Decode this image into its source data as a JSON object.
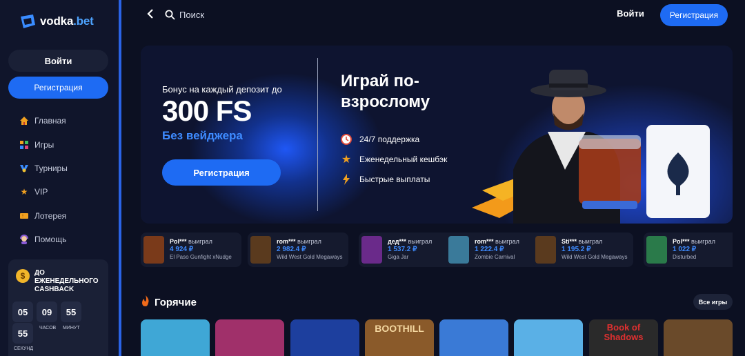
{
  "brand": {
    "name_main": "vodka",
    "name_accent": ".bet"
  },
  "sidebar": {
    "login_label": "Войти",
    "register_label": "Регистрация",
    "nav": [
      {
        "label": "Главная",
        "icon": "home-icon"
      },
      {
        "label": "Игры",
        "icon": "games-grid-icon"
      },
      {
        "label": "Турниры",
        "icon": "tournament-cup-icon"
      },
      {
        "label": "VIP",
        "icon": "star-icon"
      },
      {
        "label": "Лотерея",
        "icon": "ticket-icon"
      },
      {
        "label": "Помощь",
        "icon": "support-icon"
      }
    ],
    "cashback": {
      "title": "ДО ЕЖЕНЕДЕЛЬНОГО CASHBACK",
      "timer": [
        {
          "value": "05",
          "label": ""
        },
        {
          "value": "09",
          "label": "ЧАСОВ"
        },
        {
          "value": "55",
          "label": "МИНУТ"
        },
        {
          "value": "55",
          "label": "СЕКУНД"
        }
      ]
    }
  },
  "header": {
    "search_label": "Поиск",
    "login_label": "Войти",
    "register_label": "Регистрация"
  },
  "banner": {
    "bonus_text": "Бонус на каждый депозит до",
    "big_text": "300 FS",
    "subtext": "Без вейджера",
    "register_label": "Регистрация",
    "headline": "Играй по-взрослому",
    "features": [
      {
        "label": "24/7 поддержка",
        "icon": "clock-icon"
      },
      {
        "label": "Еженедельный кешбэк",
        "icon": "star-icon"
      },
      {
        "label": "Быстрые выплаты",
        "icon": "lightning-icon"
      }
    ]
  },
  "winners": [
    {
      "user": "Pol***",
      "won": "выиграл",
      "amount": "4 924 ₽",
      "game": "El Paso Gunfight xNudge",
      "color": "#7a3a1a"
    },
    {
      "user": "rom***",
      "won": "выиграл",
      "amount": "2 982.4 ₽",
      "game": "Wild West Gold Megaways",
      "color": "#5a3a1e"
    },
    {
      "user": "дед***",
      "won": "выиграл",
      "amount": "1 537.2 ₽",
      "game": "Giga Jar",
      "color": "#6a2a8a"
    },
    {
      "user": "rom***",
      "won": "выиграл",
      "amount": "1 222.4 ₽",
      "game": "Zombie Carnival",
      "color": "#3a7a9a"
    },
    {
      "user": "Sti***",
      "won": "выиграл",
      "amount": "1 195.2 ₽",
      "game": "Wild West Gold Megaways",
      "color": "#5a3a1e"
    },
    {
      "user": "Pol***",
      "won": "выиграл",
      "amount": "1 022 ₽",
      "game": "Disturbed",
      "color": "#2a7a4a"
    }
  ],
  "hot": {
    "title": "Горячие",
    "all_label": "Все игры",
    "games": [
      {
        "label": "",
        "color": "#3fa7d6"
      },
      {
        "label": "",
        "color": "#a0306a"
      },
      {
        "label": "",
        "color": "#1d3f9e"
      },
      {
        "label": "BOOTHILL",
        "color": "#8a5a2a"
      },
      {
        "label": "",
        "color": "#3a7ad6"
      },
      {
        "label": "",
        "color": "#5ab0e6"
      },
      {
        "label": "Book of Shadows",
        "color": "#2a2a2a"
      },
      {
        "label": "",
        "color": "#6a4a2a"
      }
    ]
  }
}
